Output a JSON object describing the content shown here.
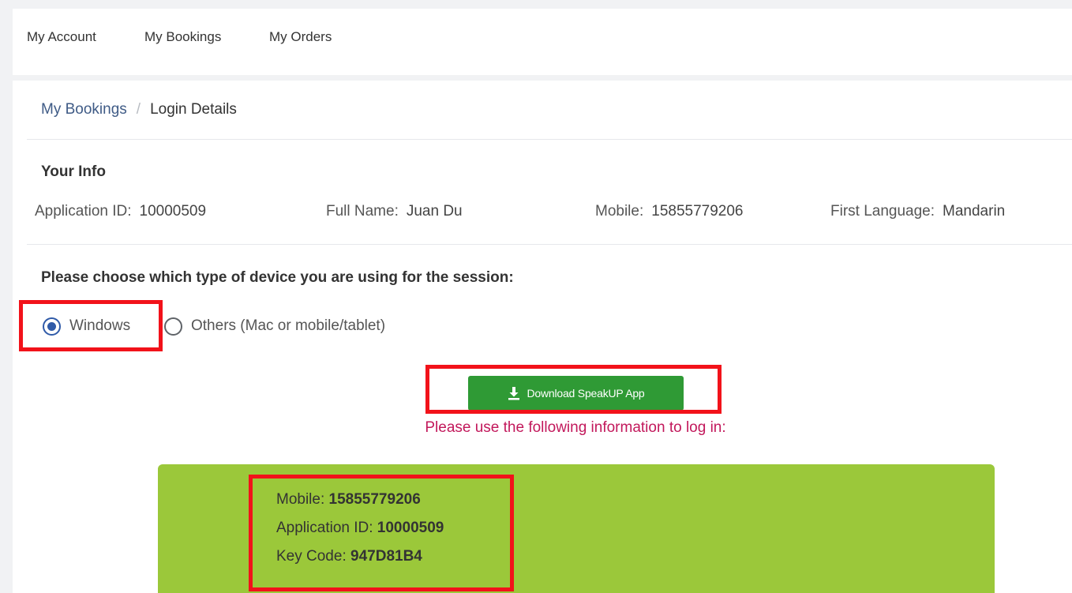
{
  "topnav": {
    "my_account": "My Account",
    "my_bookings": "My Bookings",
    "my_orders": "My Orders"
  },
  "breadcrumb": {
    "parent": "My Bookings",
    "separator": "/",
    "current": "Login Details"
  },
  "your_info": {
    "title": "Your Info",
    "application_id_label": "Application ID:",
    "application_id": "10000509",
    "full_name_label": "Full Name:",
    "full_name": "Juan Du",
    "mobile_label": "Mobile:",
    "mobile": "15855779206",
    "first_language_label": "First Language:",
    "first_language": "Mandarin"
  },
  "device": {
    "question": "Please choose which type of device you are using for the session:",
    "options": [
      {
        "label": "Windows",
        "selected": true
      },
      {
        "label": "Others (Mac or mobile/tablet)",
        "selected": false
      }
    ]
  },
  "download_button": {
    "label": "Download SpeakUP App",
    "icon": "download-icon",
    "color": "#2f9a35"
  },
  "notice": "Please use the following information to log in:",
  "credentials": {
    "mobile_label": "Mobile:",
    "mobile": "15855779206",
    "application_id_label": "Application ID:",
    "application_id": "10000509",
    "key_code_label": "Key Code:",
    "key_code": "947D81B4",
    "box_color": "#9bc83a"
  },
  "colors": {
    "highlight": "#f2121a",
    "notice": "#c2185b",
    "link": "#3f5b86"
  }
}
